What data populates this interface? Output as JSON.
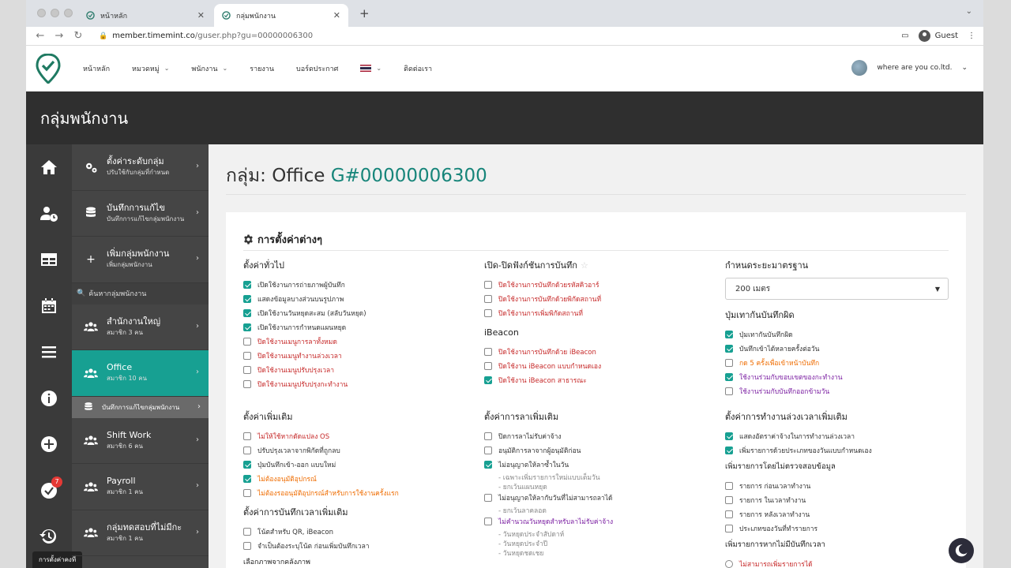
{
  "browser": {
    "tabs": [
      {
        "label": "หน้าหลัก"
      },
      {
        "label": "กลุ่มพนักงาน"
      }
    ],
    "url_host": "member.timemint.co",
    "url_path": "/guser.php?gu=00000006300",
    "profile": "Guest"
  },
  "topnav": {
    "items": [
      "หน้าหลัก",
      "หมวดหมู่",
      "พนักงาน",
      "รายงาน",
      "บอร์ดประกาศ",
      "ติดต่อเรา"
    ],
    "company": "where are you co.ltd."
  },
  "page_header": "กลุ่มพนักงาน",
  "sidebar": {
    "items": [
      {
        "title": "ตั้งค่าระดับกลุ่ม",
        "sub": "ปรับใช้กับกลุ่มที่กำหนด"
      },
      {
        "title": "บันทึกการแก้ไข",
        "sub": "บันทึกการแก้ไขกลุ่มพนักงาน"
      },
      {
        "title": "เพิ่มกลุ่มพนักงาน",
        "sub": "เพิ่มกลุ่มพนักงาน"
      }
    ],
    "search_placeholder": "ค้นหากลุ่มพนักงาน",
    "groups": [
      {
        "title": "สำนักงานใหญ่",
        "sub": "สมาชิก 3 คน"
      },
      {
        "title": "Office",
        "sub": "สมาชิก 10 คน"
      },
      {
        "title": "Shift Work",
        "sub": "สมาชิก 6 คน"
      },
      {
        "title": "Payroll",
        "sub": "สมาชิก 1 คน"
      },
      {
        "title": "กลุ่มทดสอบที่ไม่มีกะ",
        "sub": "สมาชิก 1 คน"
      }
    ],
    "active_sub": "บันทึกการแก้ไขกลุ่มพนักงาน",
    "badge": "7",
    "tooltip": "การตั้งค่าคงที่"
  },
  "content": {
    "title_prefix": "กลุ่ม: Office",
    "title_code": "G#00000006300",
    "card_title": "การตั้งค่าต่างๆ",
    "col1": {
      "h1": "ตั้งค่าทั่วไป",
      "items1": [
        {
          "label": "เปิดใช้งานการถ่ายภาพผู้บันทึก",
          "on": true,
          "tone": "ok"
        },
        {
          "label": "แสดงข้อมูลบางส่วนบนรูปภาพ",
          "on": true,
          "tone": "ok"
        },
        {
          "label": "เปิดใช้งานวันหยุดสะสม (สลับวันหยุด)",
          "on": true,
          "tone": "ok"
        },
        {
          "label": "เปิดใช้งานการกำหนดแผนหยุด",
          "on": true,
          "tone": "ok"
        },
        {
          "label": "ปิดใช้งานเมนูการลาทั้งหมด",
          "on": false,
          "tone": "red"
        },
        {
          "label": "ปิดใช้งานเมนูทำงานล่วงเวลา",
          "on": false,
          "tone": "red"
        },
        {
          "label": "ปิดใช้งานเมนูปรับปรุงเวลา",
          "on": false,
          "tone": "red"
        },
        {
          "label": "ปิดใช้งานเมนูปรับปรุงกะทำงาน",
          "on": false,
          "tone": "red"
        }
      ],
      "h2": "ตั้งค่าเพิ่มเติม",
      "items2": [
        {
          "label": "ไม่ให้ใช้หากดัดแปลง OS",
          "on": false,
          "tone": "red"
        },
        {
          "label": "ปรับปรุงเวลาจากพิกัดที่ถูกลบ",
          "on": false,
          "tone": "ok"
        },
        {
          "label": "ปุ่มบันทึกเข้า-ออก แบบใหม่",
          "on": true,
          "tone": "ok"
        },
        {
          "label": "ไม่ต้องอนุมัติอุปกรณ์",
          "on": true,
          "tone": "orange"
        },
        {
          "label": "ไม่ต้องรออนุมัติอุปกรณ์สำหรับการใช้งานครั้งแรก",
          "on": false,
          "tone": "orange"
        }
      ],
      "h3": "ตั้งค่าการบันทึกเวลาเพิ่มเติม",
      "items3": [
        {
          "label": "โน้ตสำหรับ QR, iBeacon",
          "on": false,
          "tone": "ok"
        },
        {
          "label": "จำเป็นต้องระบุโน้ต ก่อนเพิ่มบันทึกเวลา",
          "on": false,
          "tone": "ok"
        }
      ],
      "h4": "เลือกภาพจากคลังภาพ"
    },
    "col2": {
      "h1": "เปิด-ปิดฟังก์ชันการบันทึก",
      "items1": [
        {
          "label": "ปิดใช้งานการบันทึกด้วยรหัสคิวอาร์",
          "on": false,
          "tone": "red"
        },
        {
          "label": "ปิดใช้งานการบันทึกด้วยพิกัดสถานที่",
          "on": false,
          "tone": "red"
        },
        {
          "label": "ปิดใช้งานการเพิ่มพิกัดสถานที่",
          "on": false,
          "tone": "red"
        }
      ],
      "h_ibeacon": "iBeacon",
      "items_ibeacon": [
        {
          "label": "ปิดใช้งานการบันทึกด้วย iBeacon",
          "on": false,
          "tone": "red"
        },
        {
          "label": "ปิดใช้งาน iBeacon แบบกำหนดเอง",
          "on": false,
          "tone": "red"
        },
        {
          "label": "ปิดใช้งาน iBeacon สาธารณะ",
          "on": true,
          "tone": "red"
        }
      ],
      "h2": "ตั้งค่าการลาเพิ่มเติม",
      "items2a": [
        {
          "label": "ปิดการลาไม่รับค่าจ้าง",
          "on": false,
          "tone": "ok"
        },
        {
          "label": "อนุมัติการลาจากผู้อนุมัติก่อน",
          "on": false,
          "tone": "ok"
        },
        {
          "label": "ไม่อนุญาตให้ลาซ้ำในวัน",
          "on": true,
          "tone": "ok"
        }
      ],
      "subs_a": [
        "- เฉพาะเพิ่มรายการใหม่แบบเต็มวัน",
        "- ยกเว้นแผนหยุด"
      ],
      "item2b": {
        "label": "ไม่อนุญาตให้ลากับวันที่ไม่สามารถลาได้",
        "on": false,
        "tone": "ok"
      },
      "subs_b": [
        "- ยกเว้นลาคลอด"
      ],
      "item2c": {
        "label": "ไม่คำนวณวันหยุดสำหรับลาไม่รับค่าจ้าง",
        "on": false,
        "tone": "purple"
      },
      "subs_c": [
        "- วันหยุดประจำสัปดาห์",
        "- วันหยุดประจำปี",
        "- วันหยุดชดเชย"
      ]
    },
    "col3": {
      "h1": "กำหนดระยะมาตรฐาน",
      "distance": "200 เมตร",
      "h2": "ปุ่มเทากันบันทึกผิด",
      "items2": [
        {
          "label": "ปุ่มเทากันบันทึกผิด",
          "on": true,
          "tone": "ok"
        },
        {
          "label": "บันทึกเข้าได้หลายครั้งต่อวัน",
          "on": true,
          "tone": "ok"
        },
        {
          "label": "กด 5 ครั้งเพื่อเข้าหน้าบันทึก",
          "on": false,
          "tone": "orange"
        },
        {
          "label": "ใช้งานร่วมกับขอบเขตของกะทำงาน",
          "on": true,
          "tone": "purple"
        },
        {
          "label": "ใช้งานร่วมกับบันทึกออกข้ามวัน",
          "on": false,
          "tone": "purple"
        }
      ],
      "h3": "ตั้งค่าการทำงานล่วงเวลาเพิ่มเติม",
      "items3": [
        {
          "label": "แสดงอัตราค่าจ้างในการทำงานล่วงเวลา",
          "on": true,
          "tone": "ok"
        },
        {
          "label": "เพิ่มรายการด้วยประเภทของวันแบบกำหนดเอง",
          "on": true,
          "tone": "ok"
        }
      ],
      "h4": "เพิ่มรายการโดยไม่ตรวจสอบข้อมูล",
      "items4": [
        {
          "label": "รายการ ก่อนเวลาทำงาน",
          "on": false,
          "tone": "ok"
        },
        {
          "label": "รายการ ในเวลาทำงาน",
          "on": false,
          "tone": "ok"
        },
        {
          "label": "รายการ หลังเวลาทำงาน",
          "on": false,
          "tone": "ok"
        },
        {
          "label": "ประเภทของวันที่ทำรายการ",
          "on": false,
          "tone": "ok"
        }
      ],
      "h5": "เพิ่มรายการหากไม่มีบันทึกเวลา",
      "radio1": "ไม่สามารถเพิ่มรายการได้"
    }
  }
}
